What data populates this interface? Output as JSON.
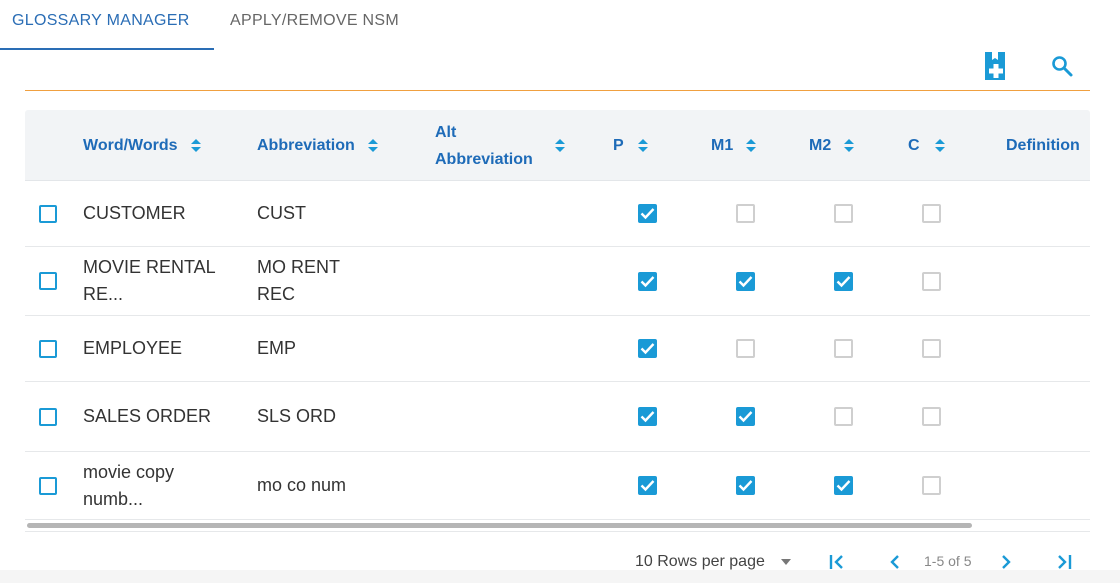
{
  "tabs": [
    {
      "label": "GLOSSARY MANAGER",
      "active": true
    },
    {
      "label": "APPLY/REMOVE NSM",
      "active": false
    }
  ],
  "toolbar": {
    "add_icon": "add-document-icon",
    "search_icon": "search-icon"
  },
  "colors": {
    "accent": "#1a9ad6",
    "header_text": "#1e6bb8",
    "tab_active": "#2a6db5",
    "divider": "#f0a040"
  },
  "table": {
    "columns": [
      {
        "label": "Word/Words"
      },
      {
        "label": "Abbreviation"
      },
      {
        "label": "Alt Abbreviation"
      },
      {
        "label": "P"
      },
      {
        "label": "M1"
      },
      {
        "label": "M2"
      },
      {
        "label": "C"
      },
      {
        "label": "Definition"
      }
    ],
    "rows": [
      {
        "word": "CUSTOMER",
        "abbr": "CUST",
        "alt": "",
        "P": true,
        "M1": false,
        "M2": false,
        "C": false,
        "definition": ""
      },
      {
        "word": "MOVIE RENTAL RE...",
        "abbr": "MO RENT REC",
        "alt": "",
        "P": true,
        "M1": true,
        "M2": true,
        "C": false,
        "definition": ""
      },
      {
        "word": "EMPLOYEE",
        "abbr": "EMP",
        "alt": "",
        "P": true,
        "M1": false,
        "M2": false,
        "C": false,
        "definition": ""
      },
      {
        "word": "SALES ORDER",
        "abbr": "SLS ORD",
        "alt": "",
        "P": true,
        "M1": true,
        "M2": false,
        "C": false,
        "definition": ""
      },
      {
        "word": "movie copy numb...",
        "abbr": "mo co num",
        "alt": "",
        "P": true,
        "M1": true,
        "M2": true,
        "C": false,
        "definition": ""
      }
    ]
  },
  "pagination": {
    "rows_per_page": "10 Rows per page",
    "info": "1-5 of 5"
  }
}
